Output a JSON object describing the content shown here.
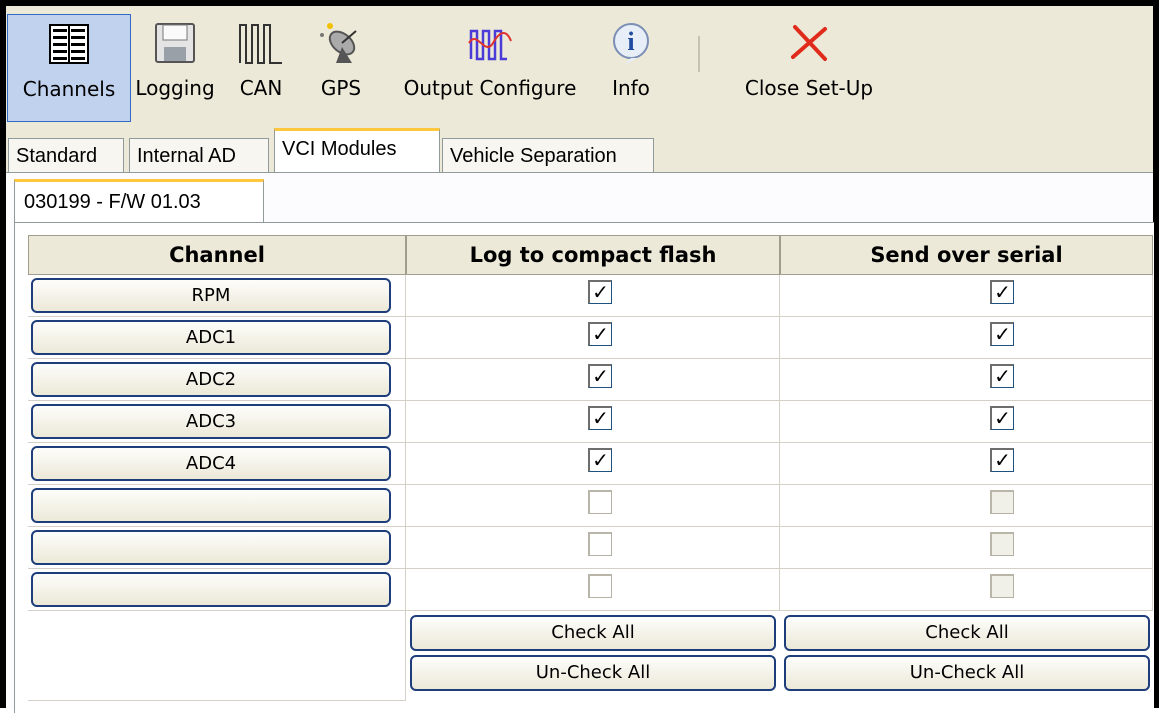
{
  "toolbar": {
    "channels": "Channels",
    "logging": "Logging",
    "can": "CAN",
    "gps": "GPS",
    "output_configure": "Output Configure",
    "info": "Info",
    "close_setup": "Close Set-Up"
  },
  "tabs": [
    "Standard",
    "Internal AD",
    "VCI Modules",
    "Vehicle Separation"
  ],
  "subtab": "030199 - F/W 01.03",
  "grid": {
    "headers": [
      "Channel",
      "Log to compact flash",
      "Send over serial"
    ],
    "rows": [
      {
        "channel": "RPM",
        "log": true,
        "serial": true
      },
      {
        "channel": "ADC1",
        "log": true,
        "serial": true
      },
      {
        "channel": "ADC2",
        "log": true,
        "serial": true
      },
      {
        "channel": "ADC3",
        "log": true,
        "serial": true
      },
      {
        "channel": "ADC4",
        "log": true,
        "serial": true
      },
      {
        "channel": "",
        "log": false,
        "serial": false
      },
      {
        "channel": "",
        "log": false,
        "serial": false
      },
      {
        "channel": "",
        "log": false,
        "serial": false
      }
    ],
    "check_all": "Check All",
    "uncheck_all": "Un-Check All"
  },
  "colors": {
    "toolbar_bg": "#ece9d8",
    "active_tab_accent": "#ffc83c",
    "button_border": "#1e3d7b"
  }
}
